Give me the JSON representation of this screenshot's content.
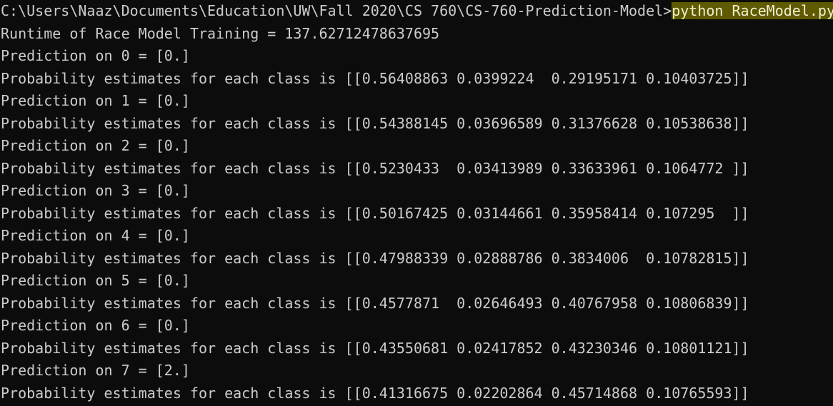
{
  "prompt": {
    "path": "C:\\Users\\Naaz\\Documents\\Education\\UW\\Fall 2020\\CS 760\\CS-760-Prediction-Model>",
    "command": "python RaceModel.py"
  },
  "output": [
    "Runtime of Race Model Training = 137.62712478637695",
    "Prediction on 0 = [0.]",
    "Probability estimates for each class is [[0.56408863 0.0399224  0.29195171 0.10403725]]",
    "Prediction on 1 = [0.]",
    "Probability estimates for each class is [[0.54388145 0.03696589 0.31376628 0.10538638]]",
    "Prediction on 2 = [0.]",
    "Probability estimates for each class is [[0.5230433  0.03413989 0.33633961 0.1064772 ]]",
    "Prediction on 3 = [0.]",
    "Probability estimates for each class is [[0.50167425 0.03144661 0.35958414 0.107295  ]]",
    "Prediction on 4 = [0.]",
    "Probability estimates for each class is [[0.47988339 0.02888786 0.3834006  0.10782815]]",
    "Prediction on 5 = [0.]",
    "Probability estimates for each class is [[0.4577871  0.02646493 0.40767958 0.10806839]]",
    "Prediction on 6 = [0.]",
    "Probability estimates for each class is [[0.43550681 0.02417852 0.43230346 0.10801121]]",
    "Prediction on 7 = [2.]",
    "Probability estimates for each class is [[0.41316675 0.02202864 0.45714868 0.10765593]]"
  ]
}
